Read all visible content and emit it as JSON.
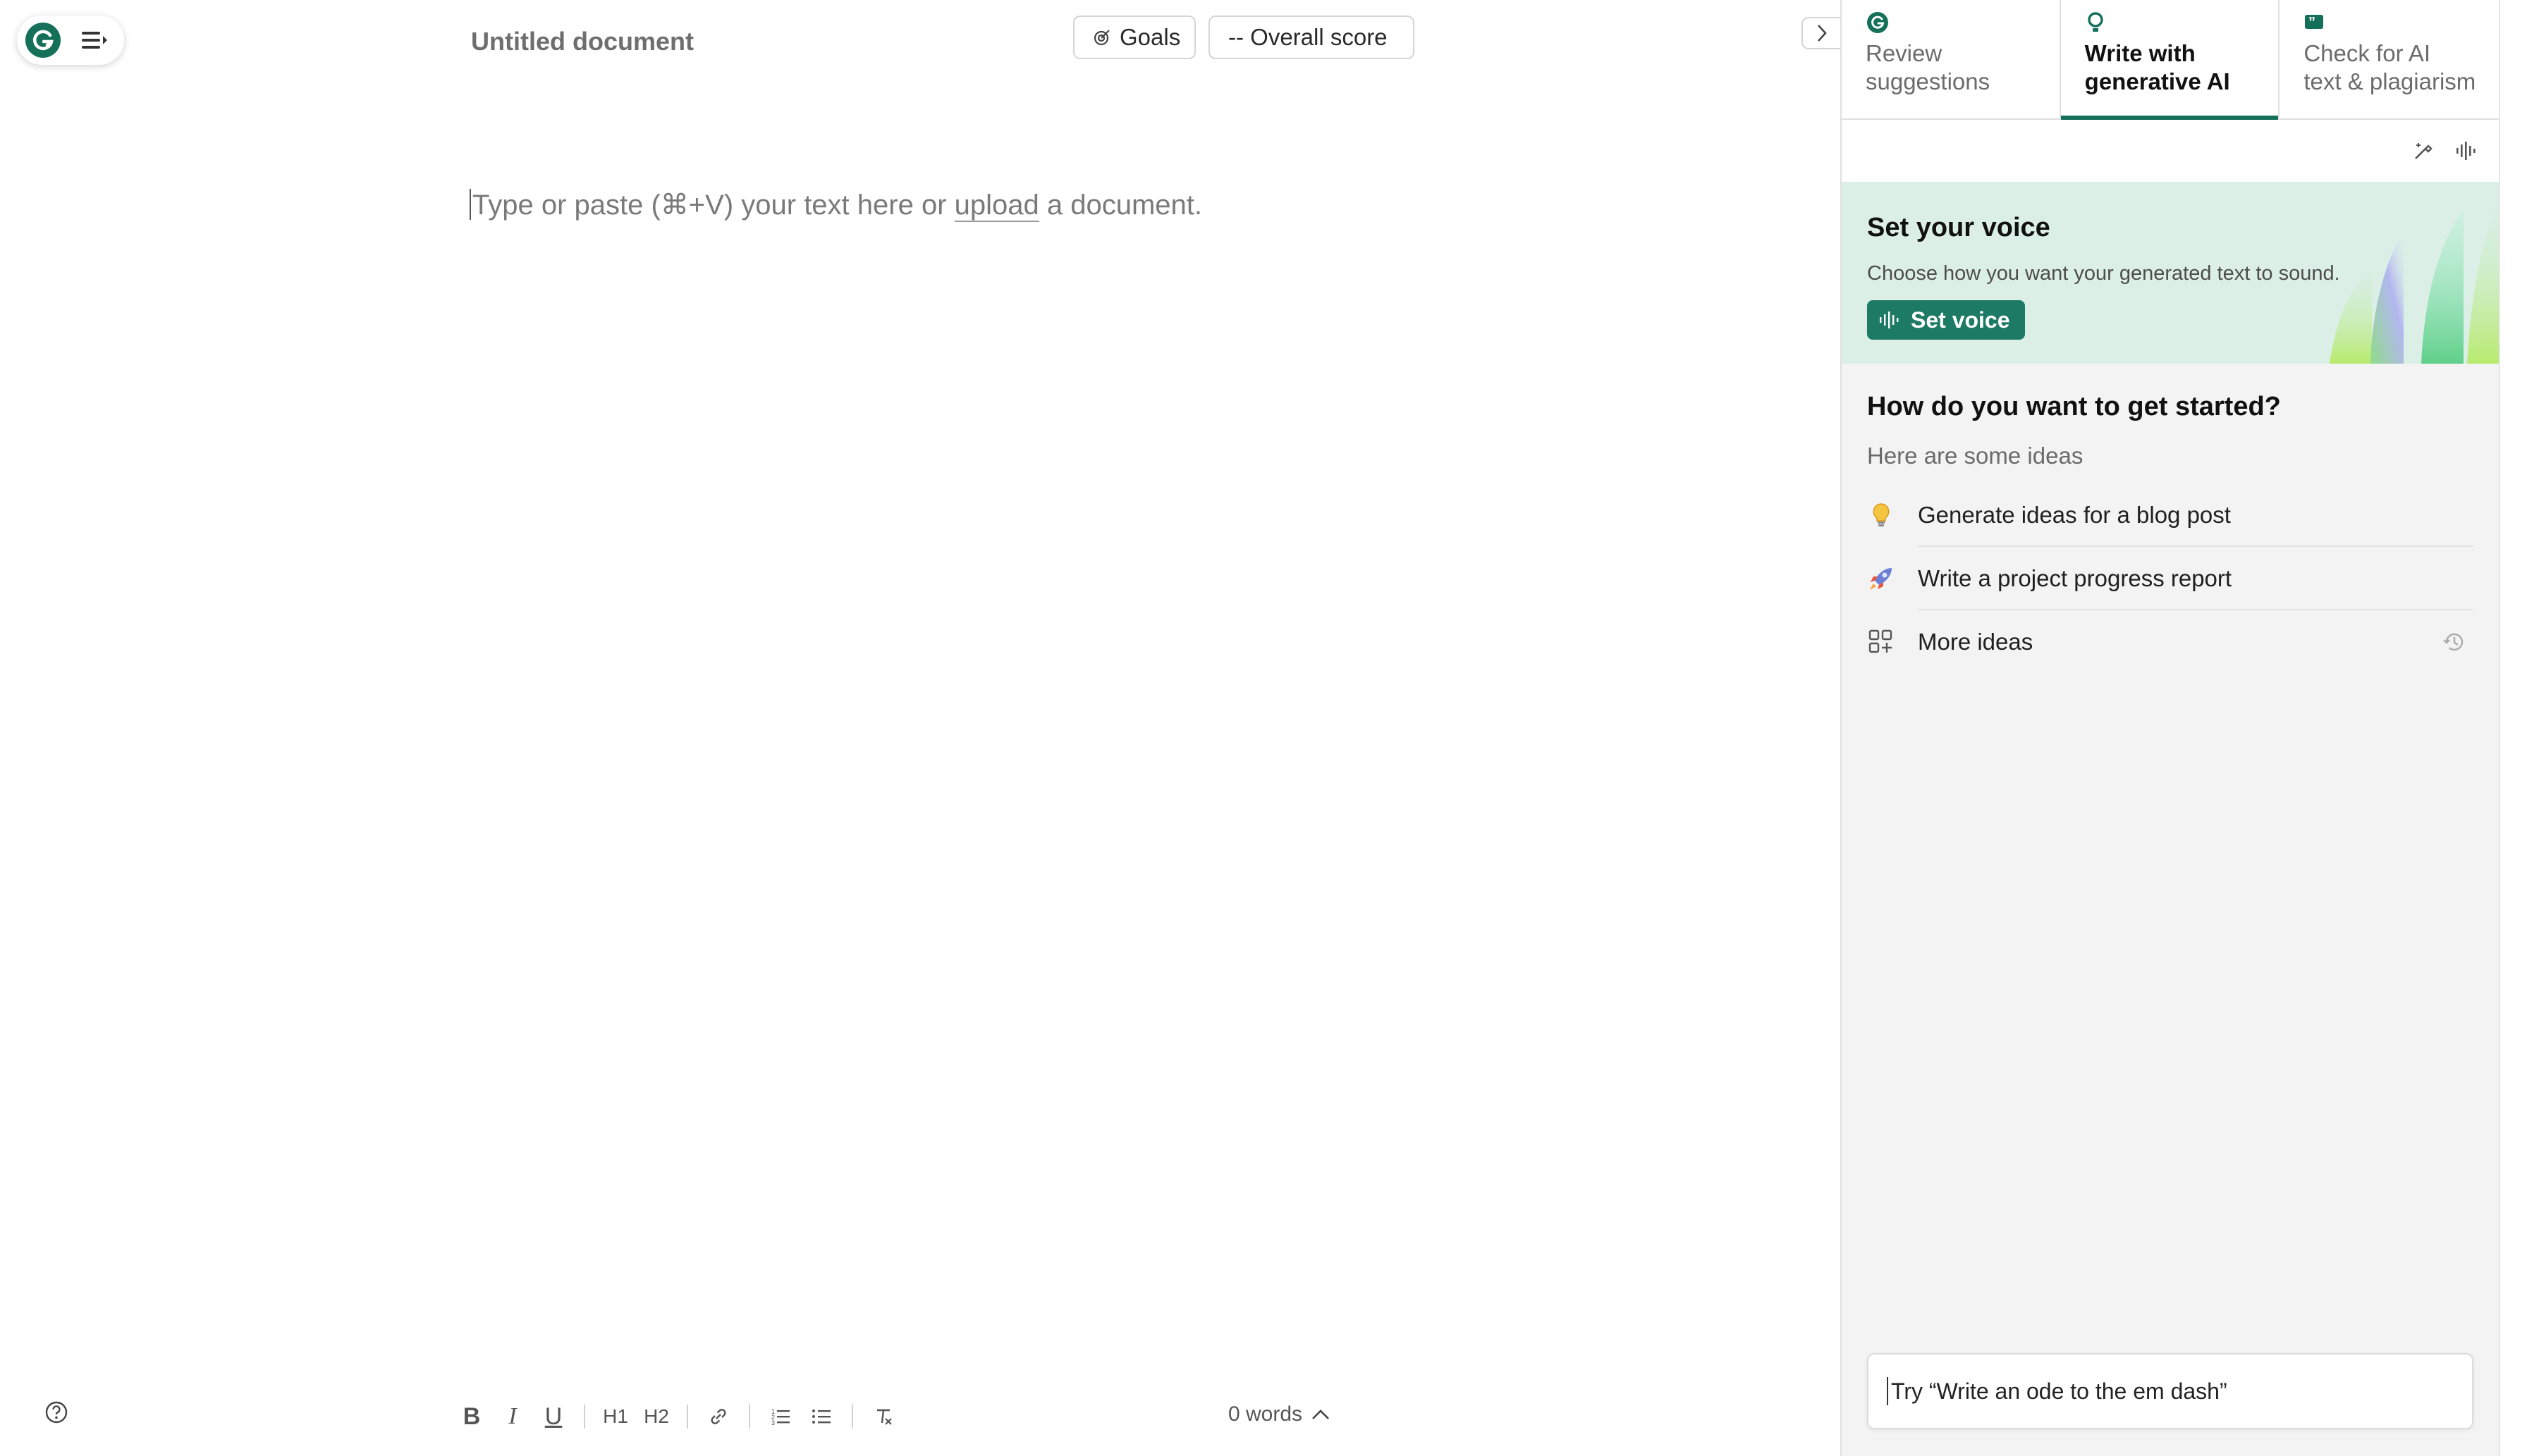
{
  "editor": {
    "title": "Untitled document",
    "goals_label": "Goals",
    "score_label": "-- Overall score",
    "placeholder_before": "Type or paste (⌘+V) your text here or ",
    "placeholder_link": "upload",
    "placeholder_after": " a document.",
    "word_count": "0 words"
  },
  "format_toolbar": {
    "bold": "B",
    "italic": "I",
    "underline": "U",
    "h1": "H1",
    "h2": "H2"
  },
  "panel": {
    "tabs": [
      {
        "label_line1": "Review",
        "label_line2": "suggestions",
        "icon": "grammarly-g-icon",
        "active": false
      },
      {
        "label_line1": "Write with",
        "label_line2": "generative AI",
        "icon": "bulb-icon",
        "active": true
      },
      {
        "label_line1": "Check for AI",
        "label_line2": "text & plagiarism",
        "icon": "quote-icon",
        "active": false
      }
    ],
    "voice": {
      "title": "Set your voice",
      "description": "Choose how you want your generated text to sound.",
      "button_label": "Set voice"
    },
    "start": {
      "title": "How do you want to get started?",
      "subtitle": "Here are some ideas",
      "ideas": [
        {
          "label": "Generate ideas for a blog post",
          "icon": "lightbulb-icon"
        },
        {
          "label": "Write a project progress report",
          "icon": "rocket-icon"
        },
        {
          "label": "More ideas",
          "icon": "grid-plus-icon"
        }
      ]
    },
    "prompt": {
      "placeholder": "Try “Write an ode to the em dash”"
    }
  },
  "colors": {
    "brand_green": "#15705a",
    "voice_card_bg": "#dcefe7",
    "panel_bg": "#f3f3f3"
  }
}
